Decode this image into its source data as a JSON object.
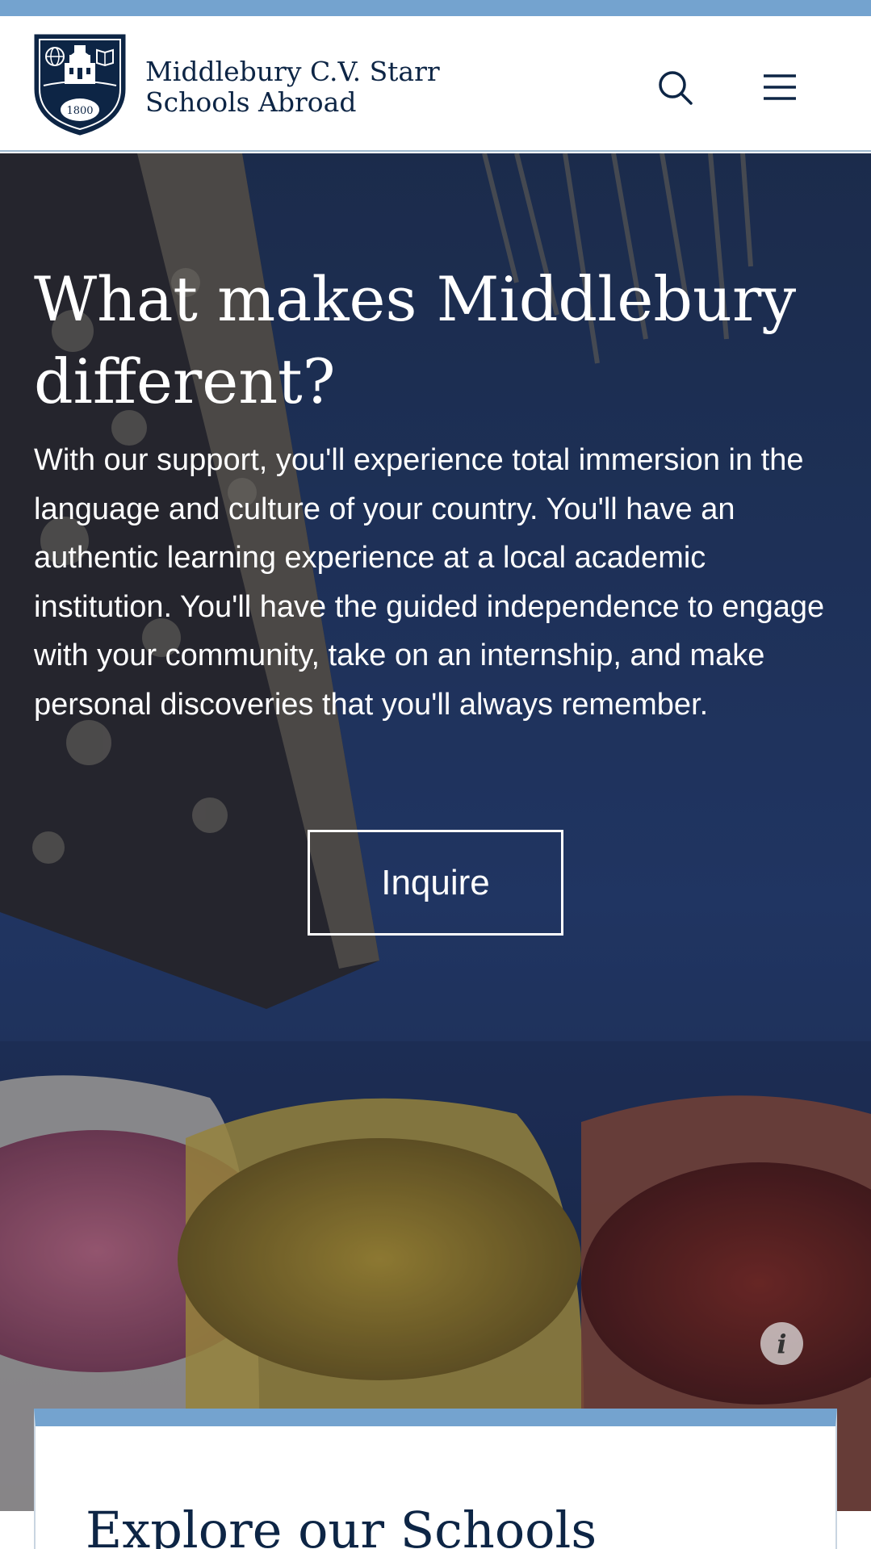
{
  "header": {
    "brand_line1": "Middlebury C.V. Starr",
    "brand_line2": "Schools Abroad",
    "crest_year": "1800",
    "search_label": "Search",
    "menu_label": "Menu"
  },
  "hero": {
    "title": "What makes Middlebury different?",
    "body": "With our support, you'll experience total immersion in the language and culture of your country. You'll have an authentic learning experience at a local academic institution. You'll have the guided independence to engage with your community, take on an internship, and make personal discoveries that you'll always remember.",
    "cta_label": "Inquire",
    "info_glyph": "i"
  },
  "explore": {
    "title": "Explore our Schools"
  },
  "colors": {
    "accent_bar": "#74a3cf",
    "brand_navy": "#0d2545",
    "hero_blue": "#223a66"
  },
  "icons": {
    "search": "search-icon",
    "menu": "hamburger-menu-icon",
    "info": "info-icon",
    "crest": "middlebury-crest-logo"
  }
}
